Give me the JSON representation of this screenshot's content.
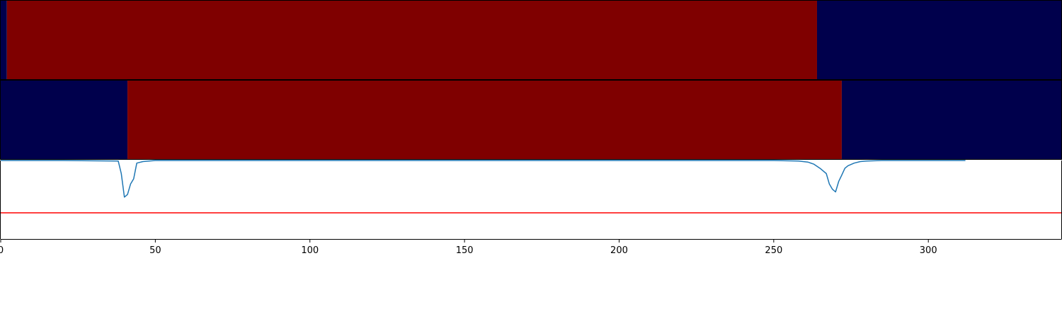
{
  "chart_data": [
    {
      "type": "heatmap",
      "title": "",
      "xlim": [
        0,
        343
      ],
      "segments": [
        {
          "from": 0,
          "to": 2,
          "value": 0
        },
        {
          "from": 2,
          "to": 264,
          "value": 1
        },
        {
          "from": 264,
          "to": 343,
          "value": 0
        }
      ],
      "colors": {
        "0": "#00004c",
        "1": "#7f0000"
      }
    },
    {
      "type": "heatmap",
      "title": "",
      "xlim": [
        0,
        343
      ],
      "segments": [
        {
          "from": 0,
          "to": 41,
          "value": 0
        },
        {
          "from": 41,
          "to": 272,
          "value": 1
        },
        {
          "from": 272,
          "to": 343,
          "value": 0
        }
      ],
      "colors": {
        "0": "#00004c",
        "1": "#7f0000"
      }
    },
    {
      "type": "line",
      "title": "",
      "xlabel": "",
      "ylabel": "",
      "xlim": [
        0,
        343
      ],
      "ylim": [
        -0.5,
        1.0
      ],
      "xticks": [
        0,
        50,
        100,
        150,
        200,
        250,
        300
      ],
      "series": [
        {
          "color": "#1f77b4",
          "x": [
            0,
            20,
            38,
            39,
            40,
            41,
            42,
            43,
            44,
            46,
            50,
            100,
            200,
            250,
            258,
            261,
            263,
            265,
            267,
            268,
            269,
            270,
            271,
            272,
            273,
            274,
            276,
            278,
            280,
            285,
            300,
            312
          ],
          "y": [
            1.0,
            1.0,
            0.99,
            0.75,
            0.3,
            0.35,
            0.55,
            0.65,
            0.95,
            0.98,
            1.0,
            1.0,
            1.0,
            1.0,
            0.99,
            0.97,
            0.93,
            0.85,
            0.75,
            0.55,
            0.45,
            0.4,
            0.6,
            0.72,
            0.85,
            0.9,
            0.95,
            0.98,
            0.99,
            1.0,
            1.0,
            1.0
          ]
        }
      ],
      "hline": {
        "y": 0.0,
        "color": "#ff0000"
      }
    }
  ]
}
